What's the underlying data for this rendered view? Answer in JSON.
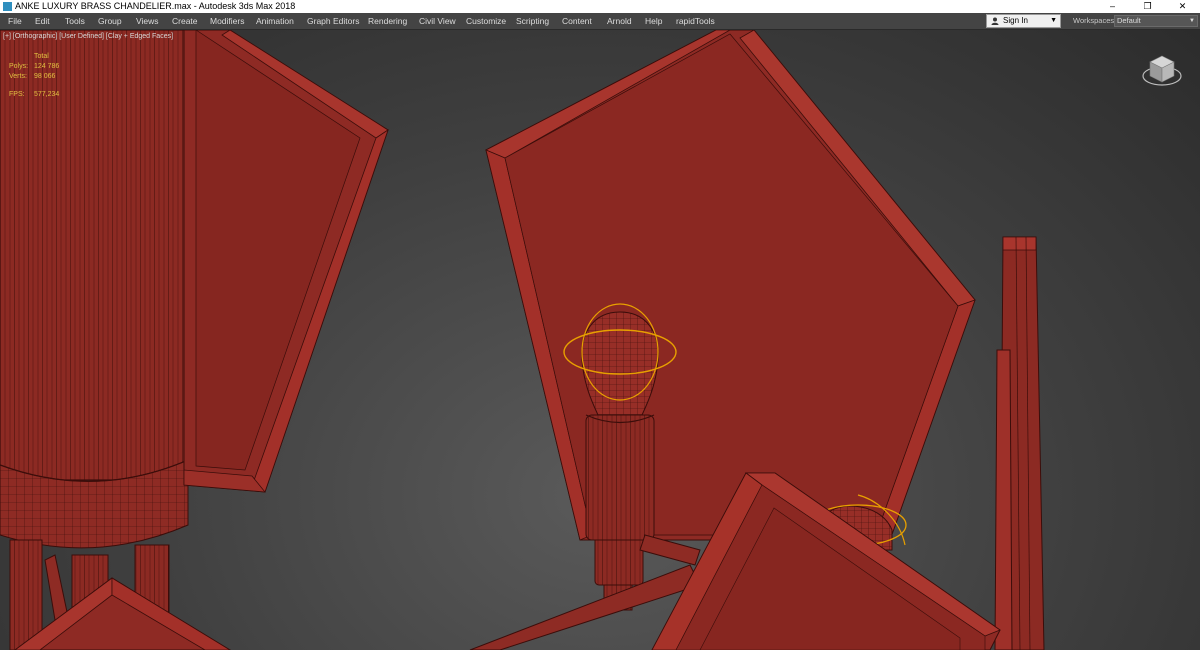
{
  "window": {
    "title": "ANKE LUXURY BRASS CHANDELIER.max - Autodesk 3ds Max 2018",
    "app_icon": "3ds-max-icon",
    "controls": {
      "minimize": "–",
      "restore": "❐",
      "close": "✕"
    }
  },
  "menu": [
    "File",
    "Edit",
    "Tools",
    "Group",
    "Views",
    "Create",
    "Modifiers",
    "Animation",
    "Graph Editors",
    "Rendering",
    "Civil View",
    "Customize",
    "Scripting",
    "Content",
    "Arnold",
    "Help",
    "rapidTools"
  ],
  "account": {
    "sign_in": "Sign In",
    "icon": "user-icon",
    "dropdown_icon": "caret-down-icon"
  },
  "workspaces": {
    "label": "Workspaces:",
    "value": "Default"
  },
  "viewport": {
    "label": "[+] [Orthographic] [User Defined] [Clay + Edged Faces]",
    "stats": {
      "header": "Total",
      "rows": [
        {
          "key": "Polys:",
          "value": "124 786"
        },
        {
          "key": "Verts:",
          "value": "98 066"
        },
        {
          "key": "FPS:",
          "value": "577,234"
        }
      ]
    },
    "viewcube_icon": "viewcube-icon",
    "colors": {
      "clay": "#8e2a24",
      "clay_frame": "#a8352d",
      "wire": "#3b0d0a",
      "selection": "#e8a000",
      "stats_text": "#e0c040"
    }
  }
}
